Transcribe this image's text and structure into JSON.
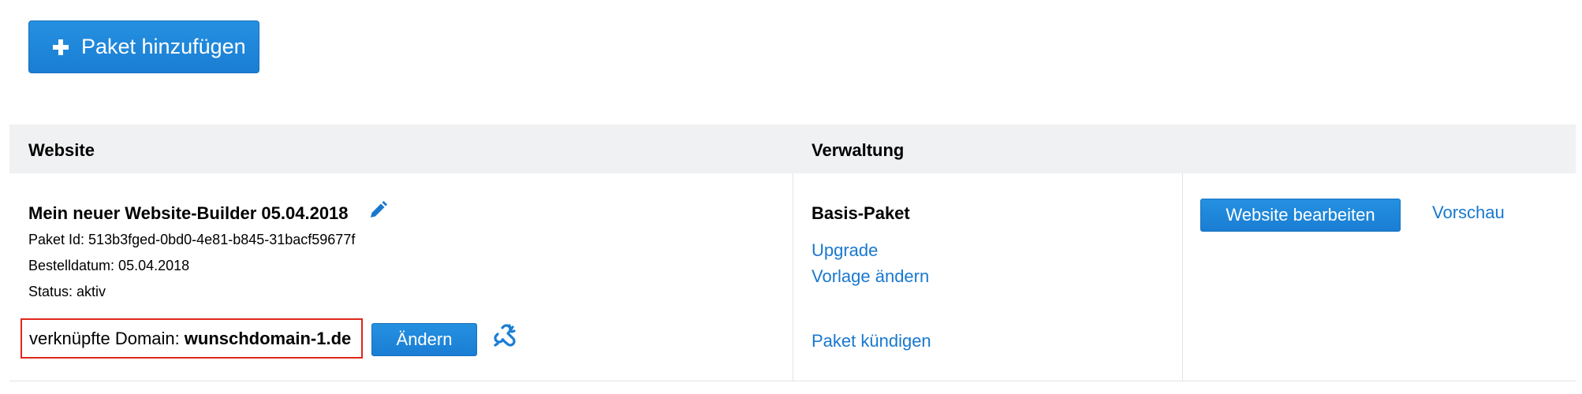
{
  "toolbar": {
    "add_label": "Paket hinzufügen",
    "add_icon": "plus-icon"
  },
  "table": {
    "columns": [
      "Website",
      "Verwaltung"
    ]
  },
  "site": {
    "title": "Mein neuer Website-Builder 05.04.2018",
    "package_id": "Paket Id: 513b3fged-0bd0-4e81-b845-31bacf59677f",
    "order_date": "Bestelldatum: 05.04.2018",
    "status": "Status: aktiv",
    "domain_label": "verknüpfte Domain:",
    "domain_value": "wunschdomain-1.de",
    "change_label": "Ändern",
    "icons": {
      "edit": "pencil-icon",
      "unlink": "unlink-icon"
    }
  },
  "management": {
    "package_name": "Basis-Paket",
    "upgrade_label": "Upgrade",
    "template_label": "Vorlage ändern",
    "cancel_label": "Paket kündigen"
  },
  "actions": {
    "edit_website_label": "Website bearbeiten",
    "preview_label": "Vorschau"
  },
  "colors": {
    "primary": "#1a7ed4",
    "link": "#1878cf",
    "header_bg": "#f0f1f2",
    "highlight": "#e0261c"
  }
}
